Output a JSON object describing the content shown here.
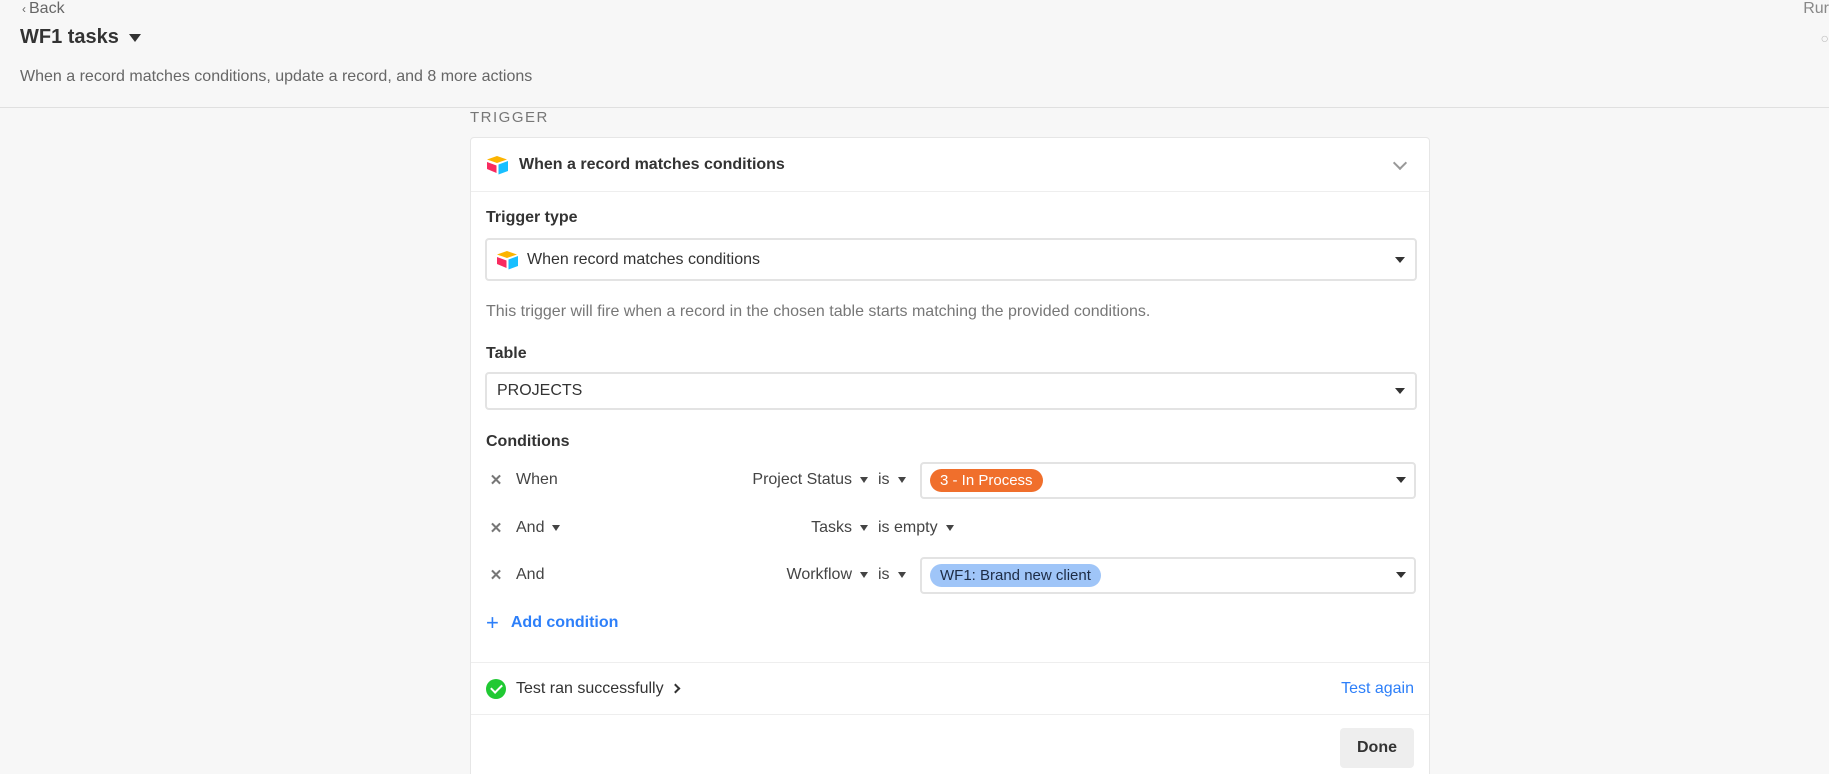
{
  "header": {
    "back_label": "Back",
    "title": "WF1 tasks",
    "subtitle": "When a record matches conditions, update a record, and 8 more actions",
    "run_label": "Rur"
  },
  "section_label": "TRIGGER",
  "trigger_card": {
    "title": "When a record matches conditions",
    "trigger_type_label": "Trigger type",
    "trigger_type_value": "When record matches conditions",
    "helper_text": "This trigger will fire when a record in the chosen table starts matching the provided conditions.",
    "table_label": "Table",
    "table_value": "PROJECTS",
    "conditions_label": "Conditions",
    "conditions": [
      {
        "conjunction": "When",
        "field": "Project Status",
        "operator": "is",
        "value": "3 - In Process",
        "value_color": "#f06f2c"
      },
      {
        "conjunction": "And",
        "field": "Tasks",
        "operator": "is empty",
        "value": ""
      },
      {
        "conjunction": "And",
        "field": "Workflow",
        "operator": "is",
        "value": "WF1: Brand new client",
        "value_color": "#9fc5f8"
      }
    ],
    "add_condition_label": "Add condition",
    "test_status": "Test ran successfully",
    "test_again_label": "Test again",
    "done_label": "Done"
  },
  "colors": {
    "accent_blue": "#2d7ff9",
    "success_green": "#20c933"
  }
}
